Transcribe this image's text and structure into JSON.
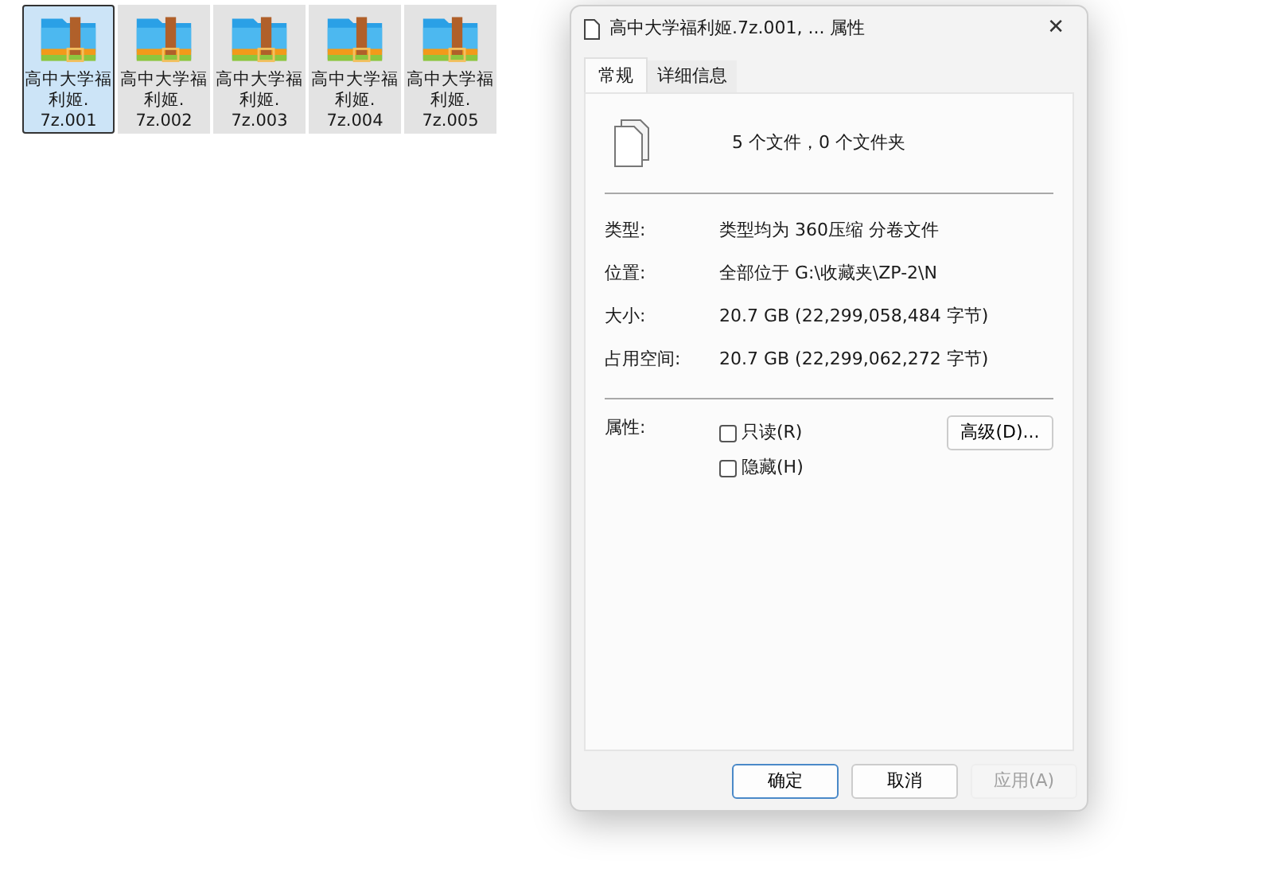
{
  "desktop_icons": [
    {
      "label_lines": [
        "高中大学福",
        "利姬.",
        "7z.001"
      ],
      "selected": true
    },
    {
      "label_lines": [
        "高中大学福",
        "利姬.",
        "7z.002"
      ],
      "selected": false
    },
    {
      "label_lines": [
        "高中大学福",
        "利姬.",
        "7z.003"
      ],
      "selected": false
    },
    {
      "label_lines": [
        "高中大学福",
        "利姬.",
        "7z.004"
      ],
      "selected": false
    },
    {
      "label_lines": [
        "高中大学福",
        "利姬.",
        "7z.005"
      ],
      "selected": false
    }
  ],
  "window": {
    "title": "高中大学福利姬.7z.001, ... 属性",
    "close": "✕"
  },
  "tabs": [
    {
      "label": "常规",
      "selected": true
    },
    {
      "label": "详细信息",
      "selected": false
    }
  ],
  "summary": "5 个文件，0 个文件夹",
  "properties": [
    {
      "label": "类型:",
      "value": "类型均为 360压缩 分卷文件"
    },
    {
      "label": "位置:",
      "value": "全部位于 G:\\收藏夹\\ZP-2\\N"
    },
    {
      "label": "大小:",
      "value": "20.7 GB (22,299,058,484 字节)"
    },
    {
      "label": "占用空间:",
      "value": "20.7 GB (22,299,062,272 字节)"
    }
  ],
  "attributes": {
    "label": "属性:",
    "checkboxes": [
      {
        "label": "只读(R)",
        "checked": false
      },
      {
        "label": "隐藏(H)",
        "checked": false
      }
    ],
    "advanced_button": "高级(D)..."
  },
  "buttons": [
    {
      "label": "确定",
      "default": true,
      "disabled": false
    },
    {
      "label": "取消",
      "default": false,
      "disabled": false
    },
    {
      "label": "应用(A)",
      "default": false,
      "disabled": true
    }
  ]
}
